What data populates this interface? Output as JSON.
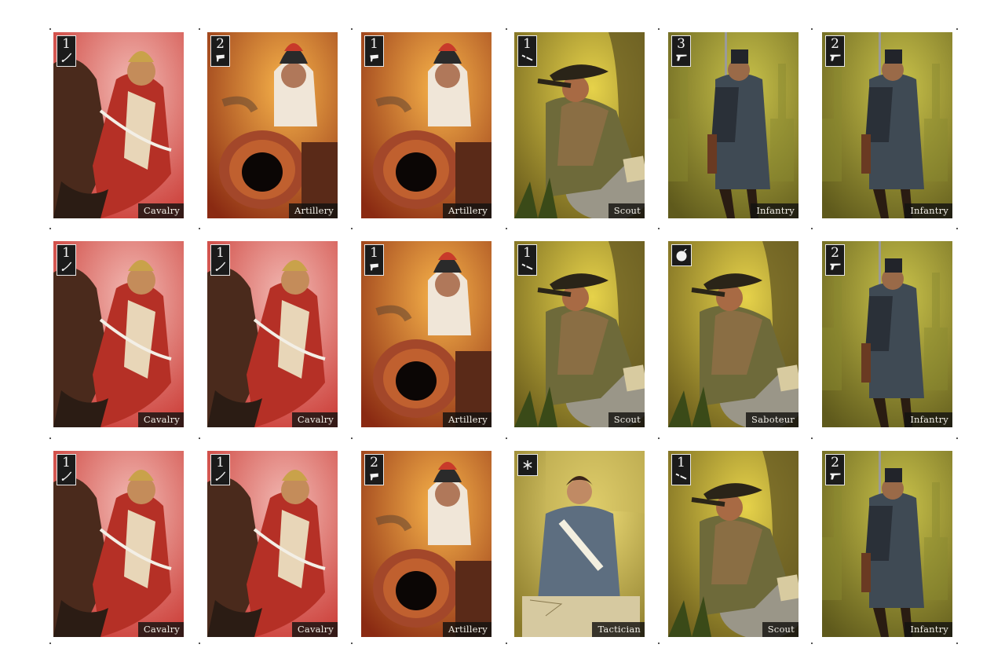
{
  "cards": [
    {
      "label": "Cavalry",
      "value": "1",
      "icon": "sabre-icon",
      "type": "cavalry"
    },
    {
      "label": "Artillery",
      "value": "2",
      "icon": "cannon-icon",
      "type": "artillery"
    },
    {
      "label": "Artillery",
      "value": "1",
      "icon": "cannon-icon",
      "type": "artillery"
    },
    {
      "label": "Scout",
      "value": "1",
      "icon": "spyglass-icon",
      "type": "scout"
    },
    {
      "label": "Infantry",
      "value": "3",
      "icon": "musket-icon",
      "type": "infantry"
    },
    {
      "label": "Infantry",
      "value": "2",
      "icon": "musket-icon",
      "type": "infantry"
    },
    {
      "label": "Cavalry",
      "value": "1",
      "icon": "sabre-icon",
      "type": "cavalry"
    },
    {
      "label": "Cavalry",
      "value": "1",
      "icon": "sabre-icon",
      "type": "cavalry"
    },
    {
      "label": "Artillery",
      "value": "1",
      "icon": "cannon-icon",
      "type": "artillery"
    },
    {
      "label": "Scout",
      "value": "1",
      "icon": "spyglass-icon",
      "type": "scout"
    },
    {
      "label": "Saboteur",
      "value": "",
      "icon": "bomb-icon",
      "type": "saboteur"
    },
    {
      "label": "Infantry",
      "value": "2",
      "icon": "musket-icon",
      "type": "infantry"
    },
    {
      "label": "Cavalry",
      "value": "1",
      "icon": "sabre-icon",
      "type": "cavalry"
    },
    {
      "label": "Cavalry",
      "value": "1",
      "icon": "sabre-icon",
      "type": "cavalry"
    },
    {
      "label": "Artillery",
      "value": "2",
      "icon": "cannon-icon",
      "type": "artillery"
    },
    {
      "label": "Tactician",
      "value": "",
      "icon": "star-icon",
      "type": "tactician"
    },
    {
      "label": "Scout",
      "value": "1",
      "icon": "spyglass-icon",
      "type": "scout"
    },
    {
      "label": "Infantry",
      "value": "2",
      "icon": "musket-icon",
      "type": "infantry"
    }
  ],
  "palette": {
    "cavalry": [
      "#f2b9b3",
      "#c8322c"
    ],
    "artillery": [
      "#f7b34a",
      "#8a2a12"
    ],
    "scout": [
      "#e6d24a",
      "#6b5d1c"
    ],
    "infantry": [
      "#c9c24a",
      "#5f5a1c"
    ],
    "saboteur": [
      "#e6d24a",
      "#6b5d1c"
    ],
    "tactician": [
      "#f2e07a",
      "#8a7a2a"
    ]
  }
}
